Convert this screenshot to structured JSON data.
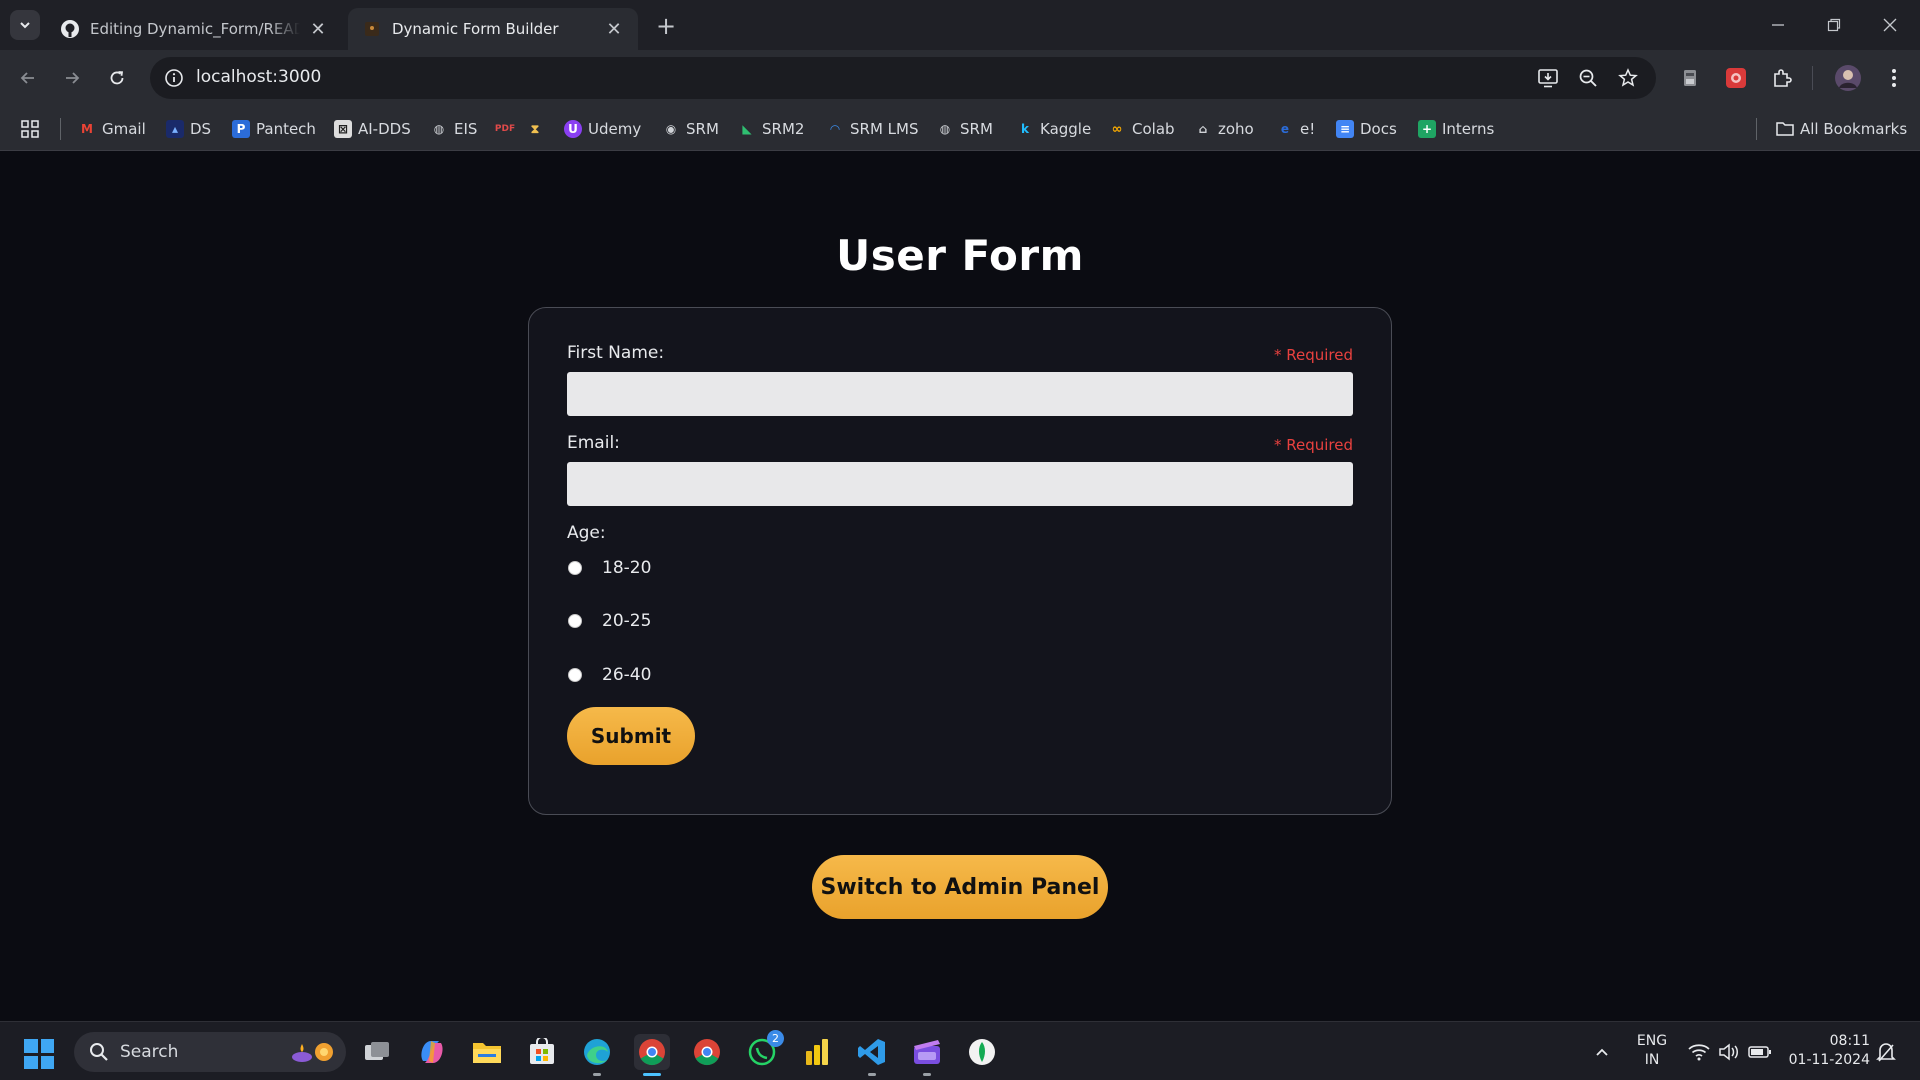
{
  "browser": {
    "tabs": [
      {
        "title": "Editing Dynamic_Form/README",
        "active": false
      },
      {
        "title": "Dynamic Form Builder",
        "active": true
      }
    ],
    "url": "localhost:3000",
    "bookmarks": [
      {
        "label": "Gmail",
        "icon": "gmail-icon"
      },
      {
        "label": "DS",
        "icon": "ds-icon"
      },
      {
        "label": "Pantech",
        "icon": "pantech-icon"
      },
      {
        "label": "AI-DDS",
        "icon": "ai-dds-icon"
      },
      {
        "label": "EIS",
        "icon": "globe-icon"
      },
      {
        "label": "",
        "icon": "pdf-icon"
      },
      {
        "label": "",
        "icon": "hourglass-icon"
      },
      {
        "label": "Udemy",
        "icon": "udemy-icon"
      },
      {
        "label": "SRM",
        "icon": "srm-icon"
      },
      {
        "label": "SRM2",
        "icon": "srm2-icon"
      },
      {
        "label": "SRM LMS",
        "icon": "srm-lms-icon"
      },
      {
        "label": "SRM",
        "icon": "globe-icon"
      },
      {
        "label": "Kaggle",
        "icon": "kaggle-icon"
      },
      {
        "label": "Colab",
        "icon": "colab-icon"
      },
      {
        "label": "zoho",
        "icon": "zoho-icon"
      },
      {
        "label": "e!",
        "icon": "e-icon"
      },
      {
        "label": "Docs",
        "icon": "docs-icon"
      },
      {
        "label": "Interns",
        "icon": "sheets-icon"
      }
    ],
    "all_bookmarks_label": "All Bookmarks"
  },
  "form": {
    "title": "User Form",
    "fields": [
      {
        "label": "First Name:",
        "required_text": "* Required",
        "value": ""
      },
      {
        "label": "Email:",
        "required_text": "* Required",
        "value": ""
      }
    ],
    "age": {
      "label": "Age:",
      "options": [
        "18-20",
        "20-25",
        "26-40"
      ],
      "selected": null
    },
    "submit_label": "Submit",
    "switch_label": "Switch to Admin Panel"
  },
  "taskbar": {
    "search_placeholder": "Search",
    "whatsapp_badge": "2",
    "lang_line1": "ENG",
    "lang_line2": "IN",
    "time": "08:11",
    "date": "01-11-2024"
  },
  "colors": {
    "accent": "#F4B13D",
    "required": "#E8413F",
    "page_bg": "#0B0C12"
  }
}
